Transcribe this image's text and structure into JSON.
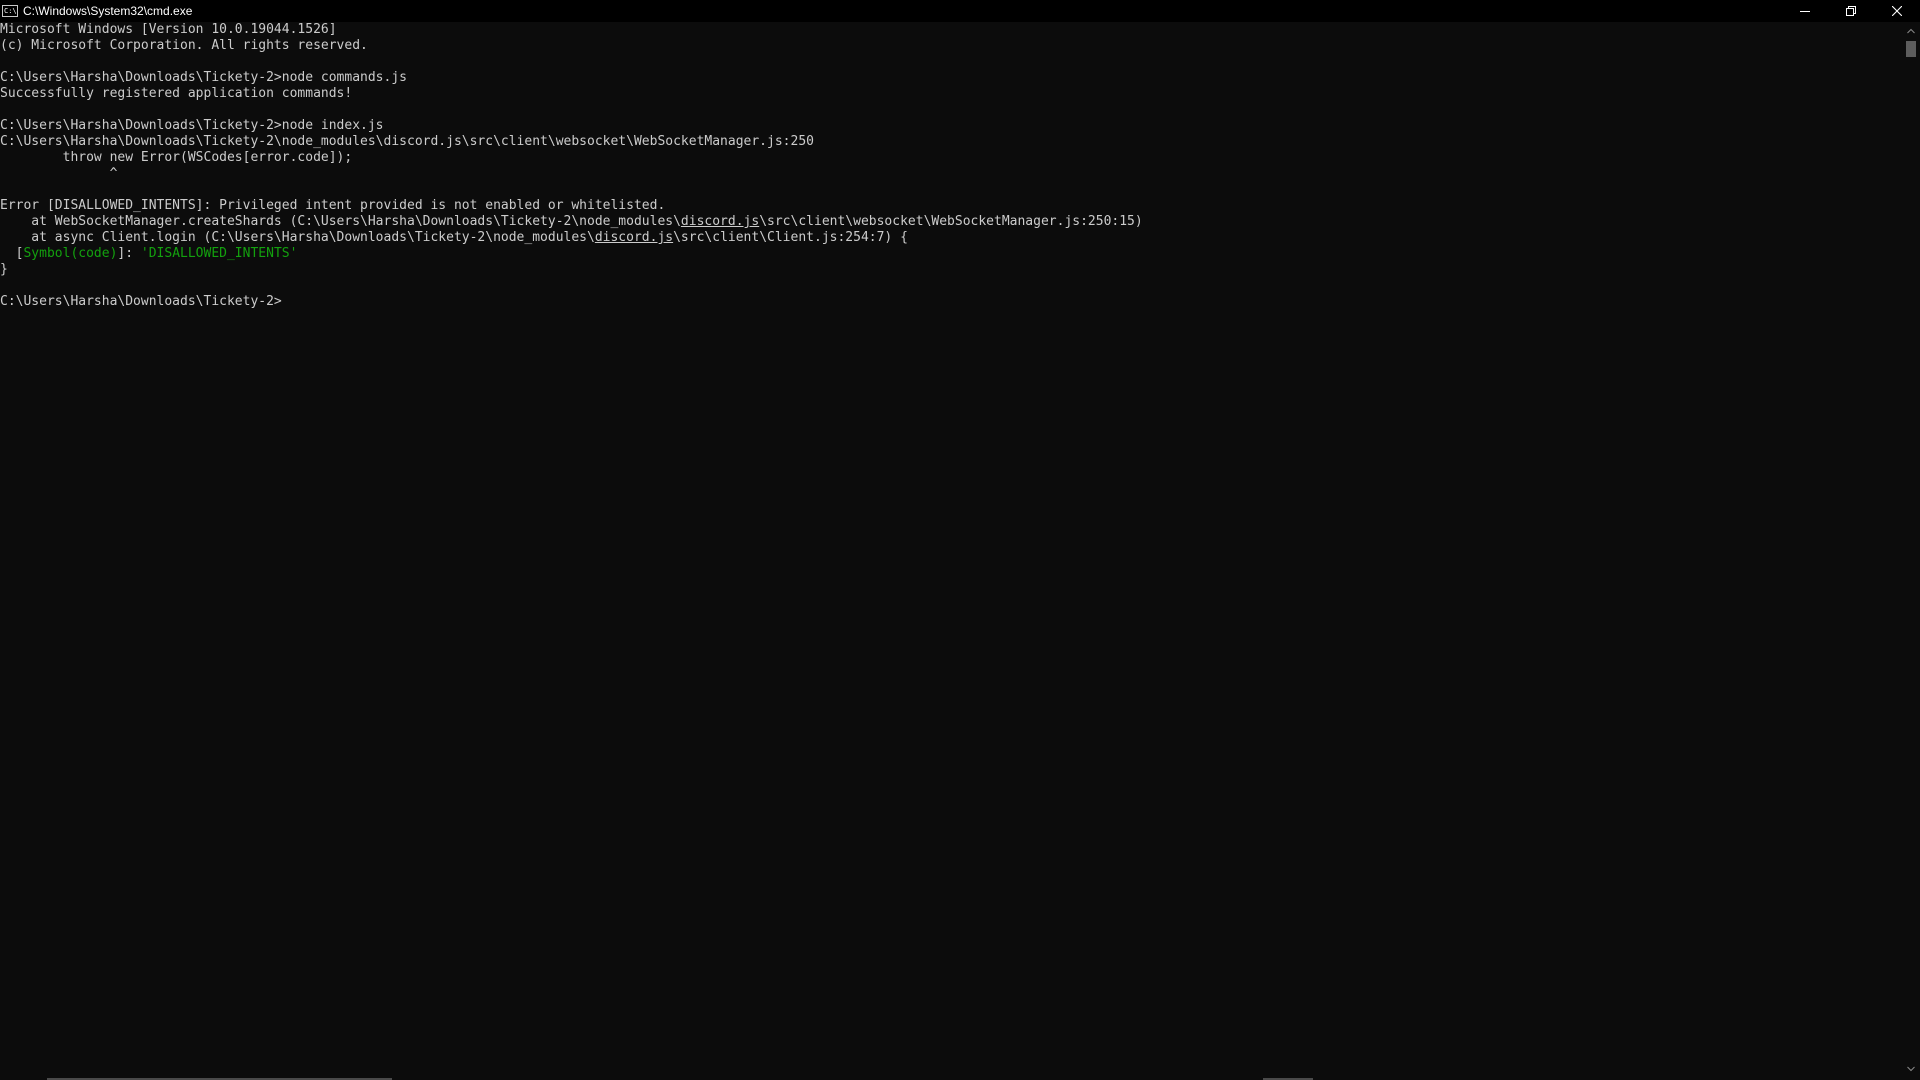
{
  "window": {
    "title": "C:\\Windows\\System32\\cmd.exe",
    "icon_label": "C:\\",
    "caption_icons": [
      "minimize-icon",
      "restore-icon",
      "close-icon"
    ]
  },
  "console": {
    "lines": [
      [
        {
          "t": "Microsoft Windows [Version 10.0.19044.1526]"
        }
      ],
      [
        {
          "t": "(c) Microsoft Corporation. All rights reserved."
        }
      ],
      [],
      [
        {
          "t": "C:\\Users\\Harsha\\Downloads\\Tickety-2>node commands.js"
        }
      ],
      [
        {
          "t": "Successfully registered application commands!"
        }
      ],
      [],
      [
        {
          "t": "C:\\Users\\Harsha\\Downloads\\Tickety-2>node index.js"
        }
      ],
      [
        {
          "t": "C:\\Users\\Harsha\\Downloads\\Tickety-2\\node_modules\\discord.js\\src\\client\\websocket\\WebSocketManager.js:250"
        }
      ],
      [
        {
          "t": "        throw new Error(WSCodes[error.code]);"
        }
      ],
      [
        {
          "t": "              ^"
        }
      ],
      [],
      [
        {
          "t": "Error [DISALLOWED_INTENTS]: Privileged intent provided is not enabled or whitelisted."
        }
      ],
      [
        {
          "t": "    at WebSocketManager.createShards (C:\\Users\\Harsha\\Downloads\\Tickety-2\\node_modules\\"
        },
        {
          "t": "discord.js",
          "s": "u"
        },
        {
          "t": "\\src\\client\\websocket\\WebSocketManager.js:250:15)"
        }
      ],
      [
        {
          "t": "    at async Client.login (C:\\Users\\Harsha\\Downloads\\Tickety-2\\node_modules\\"
        },
        {
          "t": "discord.js",
          "s": "u"
        },
        {
          "t": "\\src\\client\\Client.js:254:7) {"
        }
      ],
      [
        {
          "t": "  ["
        },
        {
          "t": "Symbol(code)",
          "s": "g"
        },
        {
          "t": "]: "
        },
        {
          "t": "'DISALLOWED_INTENTS'",
          "s": "g"
        }
      ],
      [
        {
          "t": "}"
        }
      ],
      [],
      [
        {
          "t": "C:\\Users\\Harsha\\Downloads\\Tickety-2>"
        }
      ]
    ]
  },
  "colors": {
    "background": "#0c0c0c",
    "titlebar": "#000000",
    "text": "#cccccc",
    "green": "#13a10e"
  }
}
